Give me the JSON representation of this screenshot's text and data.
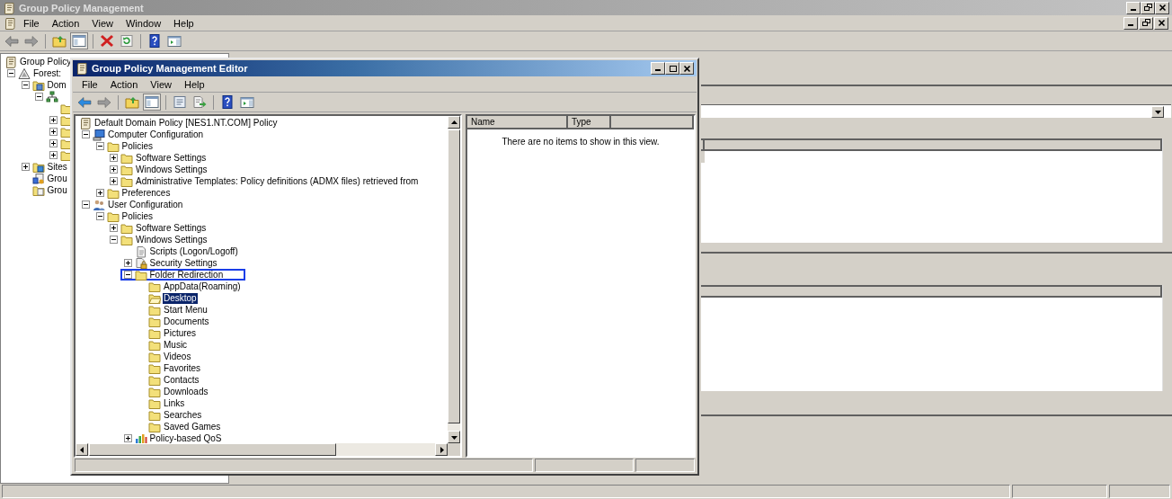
{
  "main_window": {
    "title": "Group Policy Management",
    "menu": [
      "File",
      "Action",
      "View",
      "Window",
      "Help"
    ]
  },
  "console_tree": {
    "root": {
      "label": "Group Policy",
      "kind": "console",
      "children": [
        {
          "label": "Forest:",
          "kind": "forest",
          "expanded": true,
          "children": [
            {
              "label": "Dom",
              "kind": "domain",
              "expanded": true,
              "children": [
                {
                  "kind": "ou",
                  "expanded": true,
                  "children": [
                    {
                      "kind": "folder"
                    },
                    {
                      "kind": "folder",
                      "expanded": false
                    },
                    {
                      "kind": "folder",
                      "expanded": false
                    },
                    {
                      "kind": "folder",
                      "expanded": false
                    },
                    {
                      "kind": "folder",
                      "expanded": false
                    }
                  ]
                }
              ]
            },
            {
              "label": "Sites",
              "kind": "sites",
              "expanded": false
            },
            {
              "label": "Grou",
              "kind": "gpo"
            },
            {
              "label": "Grou",
              "kind": "gpo-folder"
            }
          ]
        }
      ]
    }
  },
  "editor": {
    "title": "Group Policy Management Editor",
    "menu": [
      "File",
      "Action",
      "View",
      "Help"
    ],
    "tree": {
      "root": {
        "label": "Default Domain Policy [NES1.NT.COM] Policy",
        "kind": "scroll",
        "selected": false,
        "focused": false,
        "children": [
          {
            "label": "Computer Configuration",
            "kind": "computer",
            "expanded": true,
            "selected": false,
            "focused": false,
            "children": [
              {
                "label": "Policies",
                "kind": "folder",
                "expanded": true,
                "selected": false,
                "focused": false,
                "children": [
                  {
                    "label": "Software Settings",
                    "kind": "folder",
                    "expanded": false,
                    "selected": false,
                    "focused": false
                  },
                  {
                    "label": "Windows Settings",
                    "kind": "folder",
                    "expanded": false,
                    "selected": false,
                    "focused": false
                  },
                  {
                    "label": "Administrative Templates: Policy definitions (ADMX files) retrieved from",
                    "kind": "folder",
                    "expanded": false,
                    "selected": false,
                    "focused": false
                  }
                ]
              },
              {
                "label": "Preferences",
                "kind": "folder",
                "expanded": false,
                "selected": false,
                "focused": false
              }
            ]
          },
          {
            "label": "User Configuration",
            "kind": "users",
            "expanded": true,
            "selected": false,
            "focused": false,
            "children": [
              {
                "label": "Policies",
                "kind": "folder",
                "expanded": true,
                "selected": false,
                "focused": false,
                "children": [
                  {
                    "label": "Software Settings",
                    "kind": "folder",
                    "expanded": false,
                    "selected": false,
                    "focused": false
                  },
                  {
                    "label": "Windows Settings",
                    "kind": "folder",
                    "expanded": true,
                    "selected": false,
                    "focused": false,
                    "children": [
                      {
                        "label": "Scripts (Logon/Logoff)",
                        "kind": "script",
                        "selected": false,
                        "focused": false
                      },
                      {
                        "label": "Security Settings",
                        "kind": "security",
                        "expanded": false,
                        "selected": false,
                        "focused": false
                      },
                      {
                        "label": "Folder Redirection",
                        "kind": "folder",
                        "expanded": true,
                        "selected": false,
                        "focused": true,
                        "children": [
                          {
                            "label": "AppData(Roaming)",
                            "kind": "folder",
                            "selected": false,
                            "focused": false
                          },
                          {
                            "label": "Desktop",
                            "kind": "open-folder",
                            "selected": true,
                            "focused": false
                          },
                          {
                            "label": "Start Menu",
                            "kind": "folder",
                            "selected": false,
                            "focused": false
                          },
                          {
                            "label": "Documents",
                            "kind": "folder",
                            "selected": false,
                            "focused": false
                          },
                          {
                            "label": "Pictures",
                            "kind": "folder",
                            "selected": false,
                            "focused": false
                          },
                          {
                            "label": "Music",
                            "kind": "folder",
                            "selected": false,
                            "focused": false
                          },
                          {
                            "label": "Videos",
                            "kind": "folder",
                            "selected": false,
                            "focused": false
                          },
                          {
                            "label": "Favorites",
                            "kind": "folder",
                            "selected": false,
                            "focused": false
                          },
                          {
                            "label": "Contacts",
                            "kind": "folder",
                            "selected": false,
                            "focused": false
                          },
                          {
                            "label": "Downloads",
                            "kind": "folder",
                            "selected": false,
                            "focused": false
                          },
                          {
                            "label": "Links",
                            "kind": "folder",
                            "selected": false,
                            "focused": false
                          },
                          {
                            "label": "Searches",
                            "kind": "folder",
                            "selected": false,
                            "focused": false
                          },
                          {
                            "label": "Saved Games",
                            "kind": "folder",
                            "selected": false,
                            "focused": false
                          }
                        ]
                      },
                      {
                        "label": "Policy-based QoS",
                        "kind": "qos",
                        "expanded": false,
                        "selected": false,
                        "focused": false
                      }
                    ]
                  }
                ]
              }
            ]
          }
        ]
      }
    },
    "list": {
      "columns": [
        "Name",
        "Type"
      ],
      "empty_message": "There are no items to show in this view."
    }
  }
}
